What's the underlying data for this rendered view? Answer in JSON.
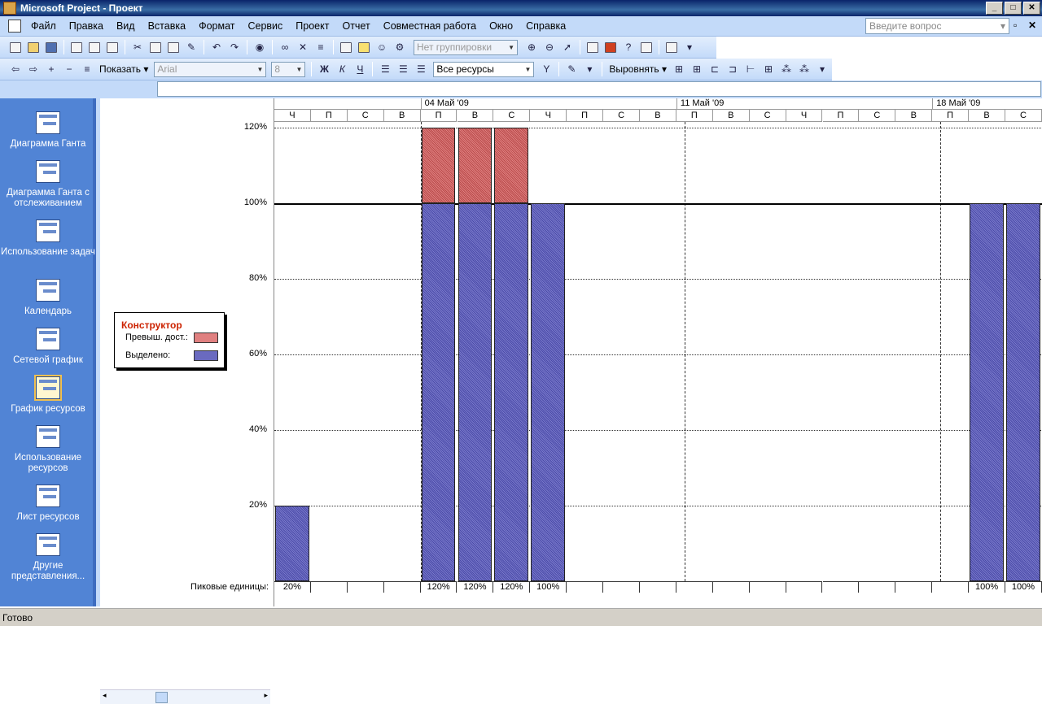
{
  "window": {
    "title": "Microsoft Project - Проект",
    "minimize": "_",
    "maximize": "□",
    "close": "✕"
  },
  "menu": [
    "Файл",
    "Правка",
    "Вид",
    "Вставка",
    "Формат",
    "Сервис",
    "Проект",
    "Отчет",
    "Совместная работа",
    "Окно",
    "Справка"
  ],
  "ask": {
    "placeholder": "Введите вопрос"
  },
  "toolbar1": {
    "grouping": "Нет группировки"
  },
  "toolbar2": {
    "show_label": "Показать",
    "font": "Arial",
    "size": "8",
    "bold": "Ж",
    "italic": "К",
    "underline": "Ч",
    "filter": "Все ресурсы",
    "align_label": "Выровнять"
  },
  "viewbar": [
    {
      "label": "Диаграмма Ганта",
      "icon": "gantt-chart-icon"
    },
    {
      "label": "Диаграмма Ганта с отслеживанием",
      "icon": "tracking-gantt-icon"
    },
    {
      "label": "Использование задач",
      "icon": "task-usage-icon"
    },
    {
      "label": "Календарь",
      "icon": "calendar-icon"
    },
    {
      "label": "Сетевой график",
      "icon": "network-diagram-icon"
    },
    {
      "label": "График ресурсов",
      "icon": "resource-graph-icon",
      "active": true
    },
    {
      "label": "Использование ресурсов",
      "icon": "resource-usage-icon"
    },
    {
      "label": "Лист ресурсов",
      "icon": "resource-sheet-icon"
    },
    {
      "label": "Другие представления...",
      "icon": "more-views-icon"
    }
  ],
  "yaxis": [
    "120%",
    "100%",
    "80%",
    "60%",
    "40%",
    "20%"
  ],
  "legend": {
    "resource": "Конструктор",
    "over": "Превыш. дост.:",
    "alloc": "Выделено:",
    "over_color": "#e08080",
    "alloc_color": "#6a6ac0"
  },
  "peak_label": "Пиковые единицы:",
  "timescale": {
    "weeks": [
      "04 Май '09",
      "11 Май '09",
      "18 Май '09"
    ],
    "days": [
      "Ч",
      "П",
      "С",
      "В",
      "П",
      "В",
      "С",
      "Ч",
      "П",
      "С",
      "В",
      "П",
      "В",
      "С",
      "Ч",
      "П",
      "С",
      "В",
      "П",
      "В",
      "С"
    ]
  },
  "chart_data": {
    "type": "bar",
    "ylabel": "",
    "ylim": [
      0,
      120
    ],
    "categories": [
      "Ч",
      "П",
      "С",
      "В",
      "П",
      "В",
      "С",
      "Ч",
      "П",
      "С",
      "В",
      "П",
      "В",
      "С",
      "Ч",
      "П",
      "С",
      "В",
      "П",
      "В",
      "С"
    ],
    "series": [
      {
        "name": "Выделено:",
        "values": [
          20,
          0,
          0,
          0,
          100,
          100,
          100,
          100,
          0,
          0,
          0,
          0,
          0,
          0,
          0,
          0,
          0,
          0,
          0,
          100,
          100
        ]
      },
      {
        "name": "Превыш. дост.:",
        "values": [
          0,
          0,
          0,
          0,
          20,
          20,
          20,
          0,
          0,
          0,
          0,
          0,
          0,
          0,
          0,
          0,
          0,
          0,
          0,
          0,
          0
        ]
      }
    ],
    "peak_units": [
      "20%",
      "",
      "",
      "",
      "120%",
      "120%",
      "120%",
      "100%",
      "",
      "",
      "",
      "",
      "",
      "",
      "",
      "",
      "",
      "",
      "",
      "100%",
      "100%"
    ]
  },
  "status": "Готово"
}
